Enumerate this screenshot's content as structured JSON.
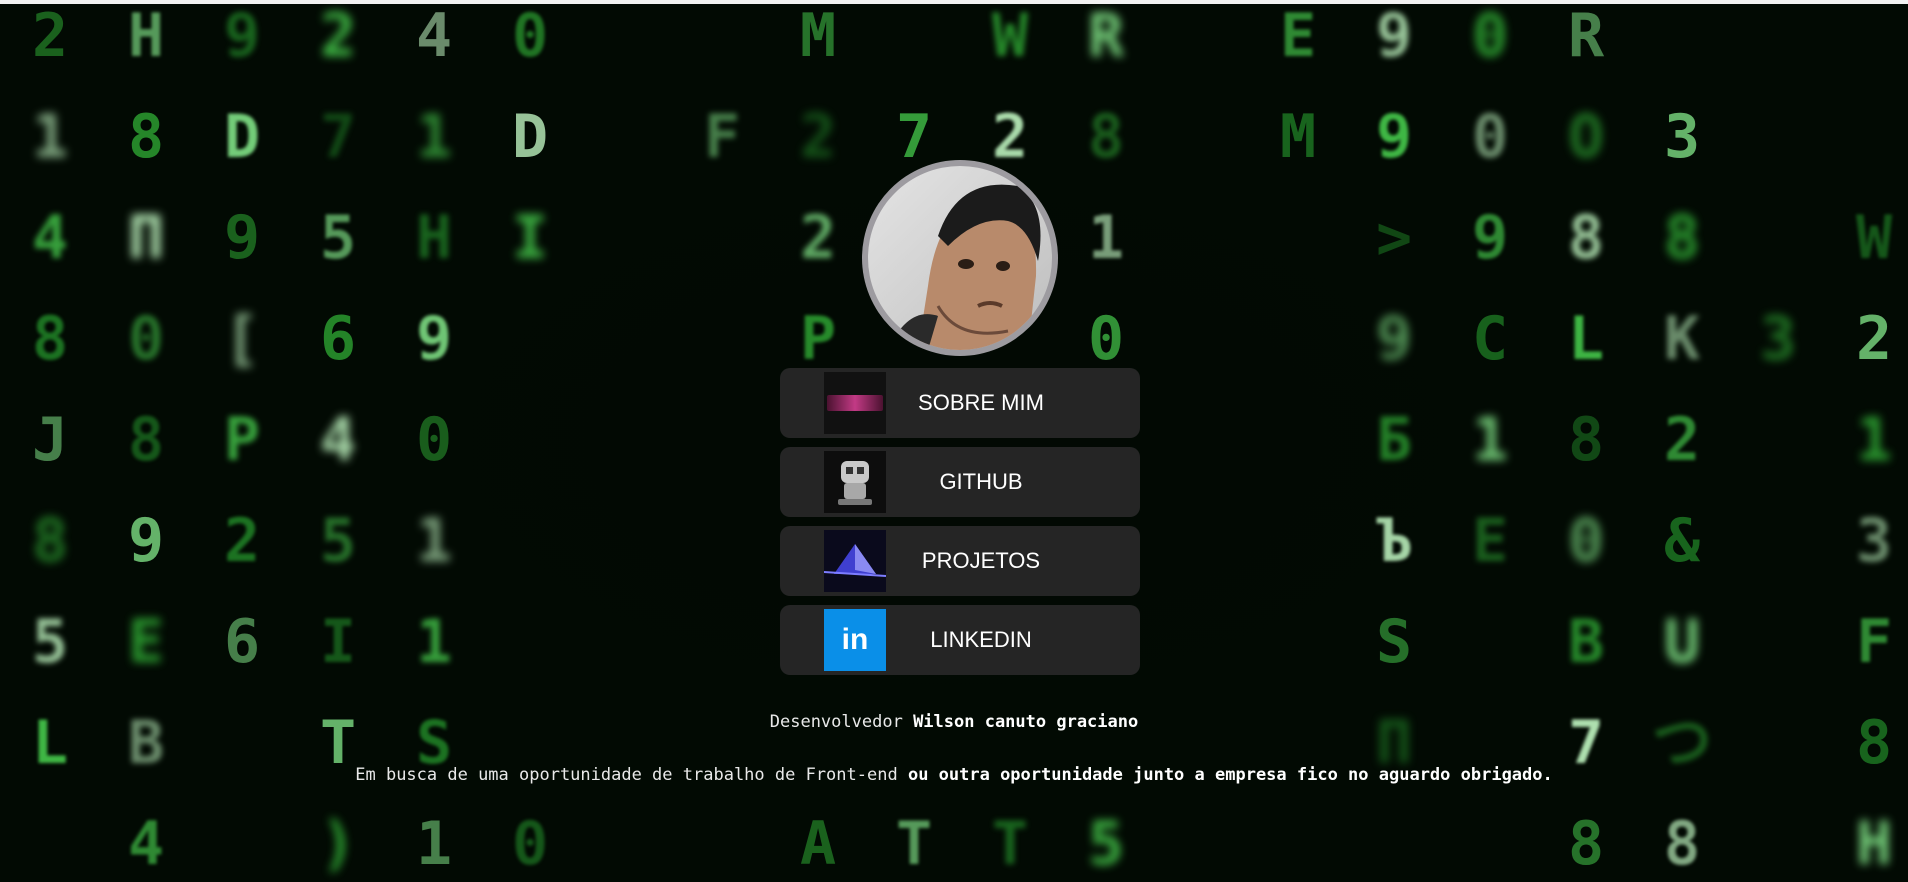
{
  "background": {
    "colors": [
      "#2fa834",
      "#45c84b",
      "#7fe085",
      "#bff5c0",
      "#1f7d25"
    ],
    "columns": [
      [
        "2",
        "1",
        "4",
        "8",
        "J",
        "8",
        "5",
        "L",
        ""
      ],
      [
        "H",
        "8",
        "П",
        "0",
        "8",
        "9",
        "E",
        "B",
        "4"
      ],
      [
        "9",
        "D",
        "9",
        "[",
        "P",
        "2",
        "6",
        "",
        ""
      ],
      [
        "2",
        "7",
        "5",
        "6",
        "4",
        "5",
        "I",
        "T",
        ")"
      ],
      [
        "4",
        "1",
        "H",
        "9",
        "0",
        "1",
        "1",
        "S",
        "1"
      ],
      [
        "0",
        "D",
        "I",
        "",
        "",
        "",
        "",
        "",
        "0"
      ],
      [
        "",
        "",
        "",
        "",
        "",
        "",
        "",
        "",
        ""
      ],
      [
        "",
        "F",
        "",
        "",
        "",
        "",
        "",
        "",
        ""
      ],
      [
        "M",
        "2",
        "2",
        "P",
        "",
        "",
        "",
        "",
        "A"
      ],
      [
        "",
        "7",
        "",
        "",
        "",
        "",
        "",
        "",
        "T"
      ],
      [
        "W",
        "2",
        "",
        "",
        "",
        "",
        "",
        "",
        "T"
      ],
      [
        "R",
        "8",
        "1",
        "0",
        "",
        "",
        "",
        "",
        "5"
      ],
      [
        "",
        "",
        "",
        "",
        "",
        "",
        "",
        "",
        ""
      ],
      [
        "E",
        "M",
        "",
        "",
        "",
        "",
        "",
        "",
        ""
      ],
      [
        "9",
        "9",
        ">",
        "9",
        "Б",
        "Ъ",
        "S",
        "П",
        ""
      ],
      [
        "0",
        "0",
        "9",
        "C",
        "1",
        "E",
        "",
        "",
        ""
      ],
      [
        "R",
        "O",
        "8",
        "L",
        "8",
        "0",
        "B",
        "7",
        "8"
      ],
      [
        "",
        "3",
        "8",
        "K",
        "2",
        "&",
        "U",
        "つ",
        "8"
      ],
      [
        "",
        "",
        "",
        "3",
        "",
        "",
        "",
        "",
        ""
      ],
      [
        "",
        "",
        "W",
        "2",
        "1",
        "3",
        "F",
        "8",
        "H"
      ]
    ]
  },
  "profile": {
    "avatar": "profile-photo"
  },
  "links": [
    {
      "label": "SOBRE MIM",
      "icon": "wilson-banner-thumbnail"
    },
    {
      "label": "GITHUB",
      "icon": "octocat-robot-thumbnail"
    },
    {
      "label": "PROJETOS",
      "icon": "blue-pyramid-thumbnail"
    },
    {
      "label": "LINKEDIN",
      "icon": "linkedin-logo",
      "icon_text": "in",
      "accent": "#0a8fe8"
    }
  ],
  "footer": {
    "role": "Desenvolvedor",
    "name": "Wilson canuto graciano",
    "message_plain": "Em busca de uma oportunidade de trabalho de Front-end",
    "message_bold": "ou outra oportunidade junto a empresa fico no aguardo obrigado."
  }
}
